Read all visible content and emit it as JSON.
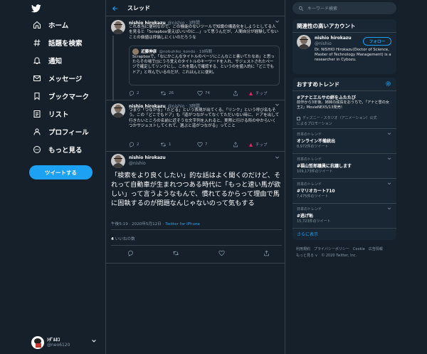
{
  "nav": {
    "items": [
      {
        "label": "ホーム"
      },
      {
        "label": "話題を検索"
      },
      {
        "label": "通知"
      },
      {
        "label": "メッセージ"
      },
      {
        "label": "ブックマーク"
      },
      {
        "label": "リスト"
      },
      {
        "label": "プロフィール"
      },
      {
        "label": "もっと見る"
      }
    ],
    "tweet_button": "ツイートする",
    "account": {
      "name": "ｼﾀﾞﾙﾈｺ",
      "handle": "@neo6120"
    }
  },
  "thread": {
    "title": "スレッド",
    "tweet1": {
      "name": "nishio hirokazu",
      "handle": "@nishio · 3時間",
      "text": "これ本当に便利なので、この機能のないツールで知識の構造化をしようとしてる人を見ると「Scrapbox使えばいいのに…」って思うんだが、人間自分が経験してないことの価値は評価しにくいのだろうな",
      "quote": {
        "name": "近藤伸彦",
        "handle": "@nobuhiko_kondo · 19時間",
        "text": "Scrapboxで，「なにかこんなタイトルのページにこんなこと書いてたなあ」と思ったらその場で[]にうろ覚えのタイトルのキーワードを入れ、サジェストされたページで確定してリンクにし、これを踏んで確認する、というのを値入的に「どこでもドア」と呼んでいるのだが、これほんとに便利。"
      },
      "replies": "2",
      "retweets": "26",
      "likes": "74",
      "tip": "チップ"
    },
    "tweet2": {
      "name": "nishio hirokazu",
      "handle": "@nishio · 3時間",
      "text": "つまり「つながる」「たどる」という表現が出てくる。「リンク」という呼び名もそう。この「どこでもドア」も「道がつながってなくてただいない時に、ドアを出して行きたいところの名前に近そうな文字列を入れると、実際に行ける所の中からいくつかサジェストしてくれて、選ぶと道がつながる」ってこと",
      "replies": "2",
      "retweets": "1",
      "likes": "7",
      "tip": "チップ"
    },
    "main": {
      "name": "nishio hirokazu",
      "handle": "@nishio",
      "text": "「検索をより良くしたい」的な話はよく聞くのだけど、それって自動車が生まれつつある時代に「もっと速い馬が欲しい」って言うようなもんで、慣れてるからって理由で馬に固執するのが問題なんじゃないのって気もする",
      "time": "午後5:19 · 2020年5月12日 · ",
      "source": "Twitter for iPhone",
      "likes_count": "4",
      "likes_label": "いいねの数"
    }
  },
  "sidebar": {
    "search_placeholder": "キーワード検索",
    "who": {
      "title": "関連性の高いアカウント",
      "name": "nishio hirokazu",
      "handle": "@nishio",
      "follow": "フォロー",
      "bio": "Dr. NISHIO Hirokazu(Doctor of Science, Master of Technology Management) is a researcher in Cybozu."
    },
    "trends": {
      "title": "おすすめトレンド",
      "promoted": {
        "name": "#アナとエルサの絆をふたたび",
        "desc": "前作から3年後、姉妹の成長をおうちで。「アナと雪の女王2」MovieNEX5/13発売！",
        "by": "ディズニー・スタジオ（アニメーション）公式",
        "label": "によるプロモーション"
      },
      "items": [
        {
          "category": "日本のトレンド",
          "name": "オンライン不備統出",
          "count": "8,972件のツイート"
        },
        {
          "category": "日本のトレンド",
          "name": "#福山哲郎議員に抗議します",
          "count": "109,173件のツイート"
        },
        {
          "category": "日本のトレンド",
          "name": "#マリオカート710",
          "count": "7,475件のツイート"
        },
        {
          "category": "日本のトレンド",
          "name": "#逃げ恥",
          "count": "15,723件のツイート"
        }
      ],
      "more": "さらに表示"
    },
    "footer": {
      "line1": "利用規約　プライバシーポリシー　Cookie　広告情報",
      "line2": "もっと見る ∨　© 2020 Twitter, Inc."
    }
  },
  "colors": {
    "accent": "#1da1f2",
    "bg": "#15202b",
    "panel": "#192734"
  }
}
